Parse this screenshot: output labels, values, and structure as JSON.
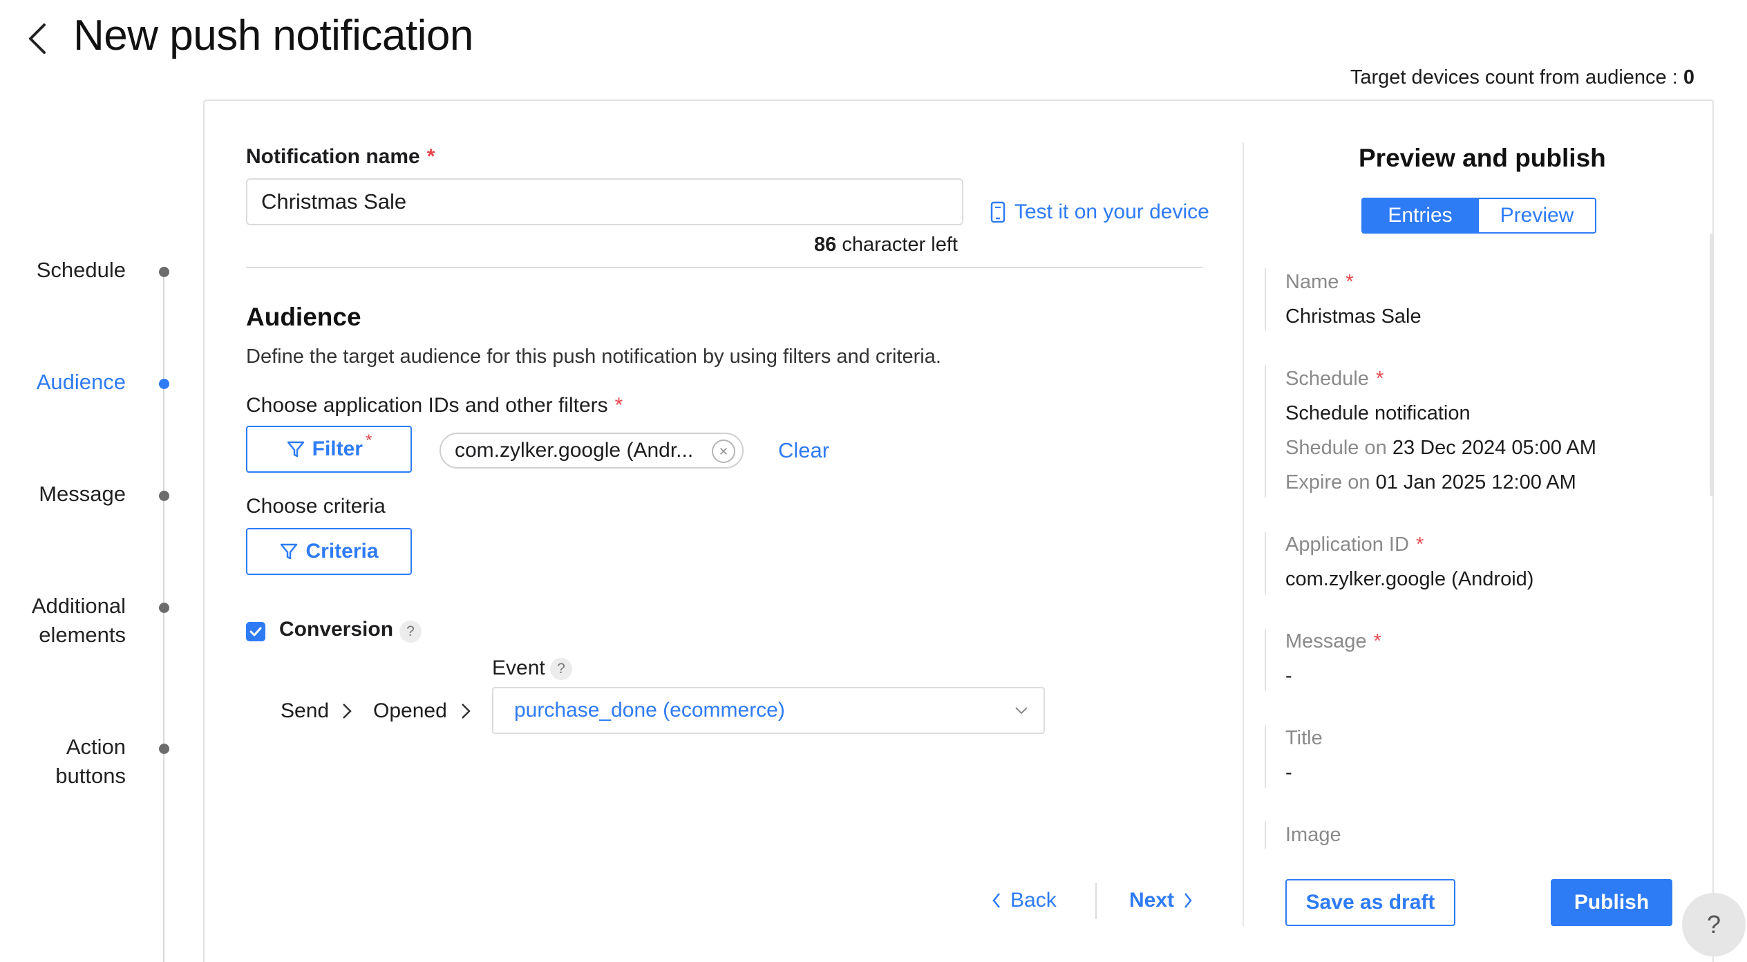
{
  "header": {
    "title": "New push notification",
    "target_count_label": "Target devices count from audience :",
    "target_count_value": "0"
  },
  "steps": [
    {
      "label": "Schedule",
      "active": false
    },
    {
      "label": "Audience",
      "active": true
    },
    {
      "label": "Message",
      "active": false
    },
    {
      "label": "Additional elements",
      "active": false
    },
    {
      "label": "Action buttons",
      "active": false
    }
  ],
  "form": {
    "notification_name_label": "Notification name",
    "required_mark": "*",
    "notification_name_value": "Christmas Sale",
    "test_device_link": "Test it on your device",
    "chars_left_count": "86",
    "chars_left_suffix": "character left"
  },
  "audience": {
    "title": "Audience",
    "description": "Define the target audience for this push notification by using filters and criteria.",
    "filters_label": "Choose application IDs and other filters",
    "filter_button": "Filter",
    "filter_chip": "com.zylker.google (Andr...",
    "clear_link": "Clear",
    "criteria_label": "Choose criteria",
    "criteria_button": "Criteria"
  },
  "conversion": {
    "label": "Conversion",
    "checked": true,
    "help": "?",
    "event_label": "Event",
    "flow_send": "Send",
    "flow_opened": "Opened",
    "event_value": "purchase_done (ecommerce)"
  },
  "navigation": {
    "back": "Back",
    "next": "Next"
  },
  "preview": {
    "title": "Preview and publish",
    "tabs": {
      "entries": "Entries",
      "preview": "Preview"
    },
    "name_label": "Name",
    "name_value": "Christmas Sale",
    "schedule_label": "Schedule",
    "schedule_value": "Schedule notification",
    "schedule_on_label": "Shedule on",
    "schedule_on_value": "23 Dec 2024 05:00 AM",
    "expire_on_label": "Expire on",
    "expire_on_value": "01 Jan 2025 12:00 AM",
    "app_id_label": "Application ID",
    "app_id_value": "com.zylker.google (Android)",
    "message_label": "Message",
    "message_value": "-",
    "title_label": "Title",
    "title_value": "-",
    "image_label": "Image",
    "save_draft": "Save as draft",
    "publish": "Publish",
    "help_fab": "?"
  },
  "colors": {
    "accent": "#2e7bf6",
    "required": "#e5484d"
  }
}
